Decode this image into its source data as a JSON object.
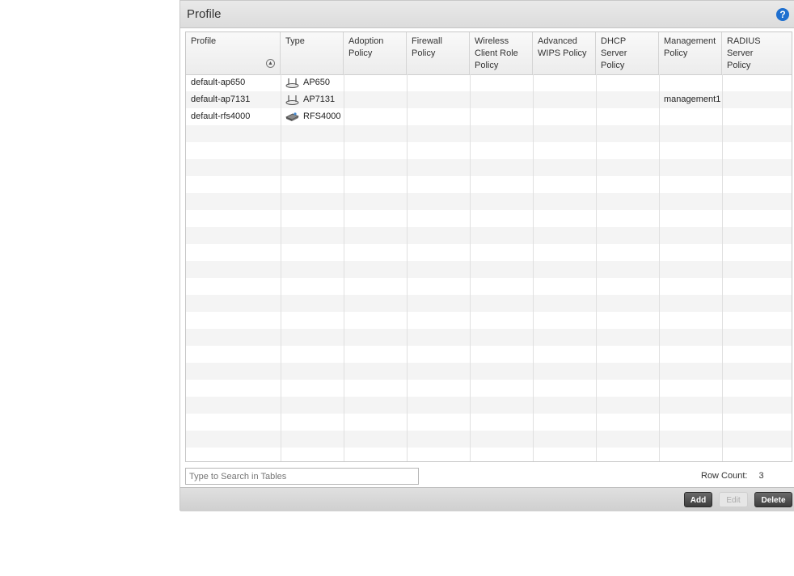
{
  "panel": {
    "title": "Profile",
    "help_icon": "?"
  },
  "table": {
    "columns": [
      {
        "line1": "Profile",
        "line2": "",
        "line3": ""
      },
      {
        "line1": "Type",
        "line2": "",
        "line3": ""
      },
      {
        "line1": "Adoption",
        "line2": "Policy",
        "line3": ""
      },
      {
        "line1": "Firewall",
        "line2": "Policy",
        "line3": ""
      },
      {
        "line1": "Wireless",
        "line2": "Client Role",
        "line3": "Policy"
      },
      {
        "line1": "Advanced",
        "line2": "WIPS Policy",
        "line3": ""
      },
      {
        "line1": "DHCP Server",
        "line2": "Policy",
        "line3": ""
      },
      {
        "line1": "Management",
        "line2": "Policy",
        "line3": ""
      },
      {
        "line1": "RADIUS Server",
        "line2": "Policy",
        "line3": ""
      }
    ],
    "sort_icon": "sort-ascending-icon",
    "rows": [
      {
        "profile": "default-ap650",
        "type": "AP650",
        "type_icon": "access-point-icon",
        "management": ""
      },
      {
        "profile": "default-ap7131",
        "type": "AP7131",
        "type_icon": "access-point-icon",
        "management": "management1"
      },
      {
        "profile": "default-rfs4000",
        "type": "RFS4000",
        "type_icon": "switch-icon",
        "management": ""
      }
    ]
  },
  "search": {
    "placeholder": "Type to Search in Tables"
  },
  "row_count": {
    "label": "Row Count:",
    "value": "3"
  },
  "buttons": {
    "add": "Add",
    "edit": "Edit",
    "delete": "Delete"
  }
}
